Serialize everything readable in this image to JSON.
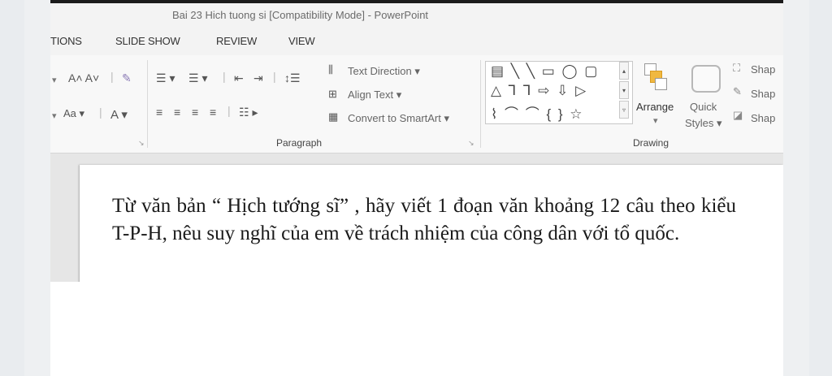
{
  "window": {
    "title": "Bai 23 Hich tuong si [Compatibility Mode] - PowerPoint"
  },
  "tabs": [
    "TIONS",
    "SLIDE SHOW",
    "REVIEW",
    "VIEW"
  ],
  "ribbon": {
    "font_group": {
      "grow_font": "A˄ A˅",
      "clear_format": "♩",
      "change_case": "Aa ▾",
      "font_color": "A ▾"
    },
    "paragraph_group": {
      "text_direction": "Text Direction ▾",
      "align_text": "Align Text ▾",
      "convert_smartart": "Convert to SmartArt ▾",
      "label": "Paragraph"
    },
    "drawing_group": {
      "arrange": "Arrange",
      "quick_styles_line1": "Quick",
      "quick_styles_line2": "Styles ▾",
      "shape_fill": "Shap",
      "shape_outline": "Shap",
      "shape_effects": "Shap",
      "label": "Drawing"
    }
  },
  "slide": {
    "body_text": "Từ văn bản “ Hịch tướng sĩ” , hãy viết 1 đoạn văn khoảng 12 câu theo kiểu T-P-H, nêu suy nghĩ của em về trách nhiệm của công dân với tổ quốc."
  }
}
